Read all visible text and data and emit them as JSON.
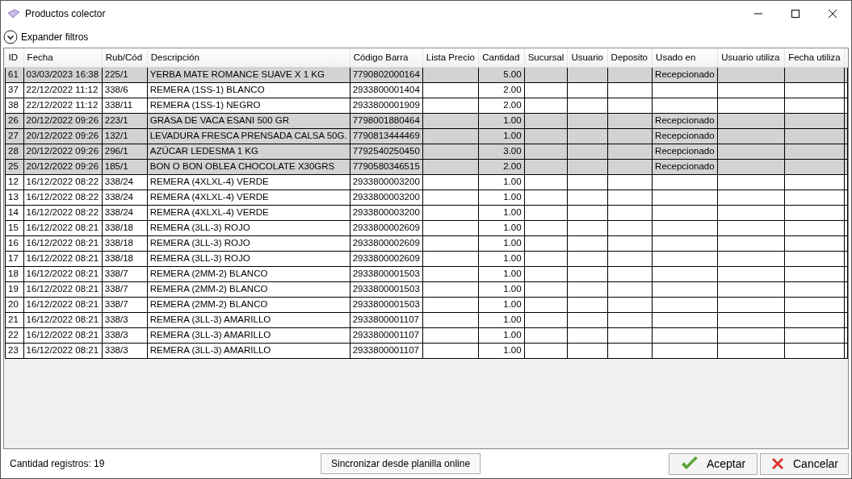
{
  "window": {
    "title": "Productos colector"
  },
  "filters_toggle": {
    "label": "Expander filtros",
    "expanded": false
  },
  "table": {
    "columns": [
      "ID",
      "Fecha",
      "Rub/Cód",
      "Descripción",
      "Código Barra",
      "Lista Precio",
      "Cantidad",
      "Sucursal",
      "Usuario",
      "Deposito",
      "Usado en",
      "Usuario utiliza",
      "Fecha utiliza"
    ],
    "rows": [
      {
        "highlighted": true,
        "cells": [
          "61",
          "03/03/2023 16:38",
          "225/1",
          "YERBA MATE ROMANCE SUAVE X 1 KG",
          "7790802000164",
          "",
          "5.00",
          "",
          "",
          "",
          "Recepcionado",
          "",
          ""
        ]
      },
      {
        "highlighted": false,
        "cells": [
          "37",
          "22/12/2022 11:12",
          "338/6",
          "REMERA (1SS-1) BLANCO",
          "2933800001404",
          "",
          "2.00",
          "",
          "",
          "",
          "",
          "",
          ""
        ]
      },
      {
        "highlighted": false,
        "cells": [
          "38",
          "22/12/2022 11:12",
          "338/11",
          "REMERA (1SS-1) NEGRO",
          "2933800001909",
          "",
          "2.00",
          "",
          "",
          "",
          "",
          "",
          ""
        ]
      },
      {
        "highlighted": true,
        "cells": [
          "26",
          "20/12/2022 09:26",
          "223/1",
          "GRASA DE VACA ESANI 500 GR",
          "7798001880464",
          "",
          "1.00",
          "",
          "",
          "",
          "Recepcionado",
          "",
          ""
        ]
      },
      {
        "highlighted": true,
        "cells": [
          "27",
          "20/12/2022 09:26",
          "132/1",
          "LEVADURA FRESCA PRENSADA CALSA 50G.",
          "7790813444469",
          "",
          "1.00",
          "",
          "",
          "",
          "Recepcionado",
          "",
          ""
        ]
      },
      {
        "highlighted": true,
        "cells": [
          "28",
          "20/12/2022 09:26",
          "296/1",
          "AZÚCAR LEDESMA 1 KG",
          "7792540250450",
          "",
          "3.00",
          "",
          "",
          "",
          "Recepcionado",
          "",
          ""
        ]
      },
      {
        "highlighted": true,
        "cells": [
          "25",
          "20/12/2022 09:26",
          "185/1",
          "BON O BON OBLEA CHOCOLATE X30GRS",
          "7790580346515",
          "",
          "2.00",
          "",
          "",
          "",
          "Recepcionado",
          "",
          ""
        ]
      },
      {
        "highlighted": false,
        "cells": [
          "12",
          "16/12/2022 08:22",
          "338/24",
          "REMERA (4XLXL-4) VERDE",
          "2933800003200",
          "",
          "1.00",
          "",
          "",
          "",
          "",
          "",
          ""
        ]
      },
      {
        "highlighted": false,
        "cells": [
          "13",
          "16/12/2022 08:22",
          "338/24",
          "REMERA (4XLXL-4) VERDE",
          "2933800003200",
          "",
          "1.00",
          "",
          "",
          "",
          "",
          "",
          ""
        ]
      },
      {
        "highlighted": false,
        "cells": [
          "14",
          "16/12/2022 08:22",
          "338/24",
          "REMERA (4XLXL-4) VERDE",
          "2933800003200",
          "",
          "1.00",
          "",
          "",
          "",
          "",
          "",
          ""
        ]
      },
      {
        "highlighted": false,
        "cells": [
          "15",
          "16/12/2022 08:21",
          "338/18",
          "REMERA (3LL-3) ROJO",
          "2933800002609",
          "",
          "1.00",
          "",
          "",
          "",
          "",
          "",
          ""
        ]
      },
      {
        "highlighted": false,
        "cells": [
          "16",
          "16/12/2022 08:21",
          "338/18",
          "REMERA (3LL-3) ROJO",
          "2933800002609",
          "",
          "1.00",
          "",
          "",
          "",
          "",
          "",
          ""
        ]
      },
      {
        "highlighted": false,
        "cells": [
          "17",
          "16/12/2022 08:21",
          "338/18",
          "REMERA (3LL-3) ROJO",
          "2933800002609",
          "",
          "1.00",
          "",
          "",
          "",
          "",
          "",
          ""
        ]
      },
      {
        "highlighted": false,
        "cells": [
          "18",
          "16/12/2022 08:21",
          "338/7",
          "REMERA (2MM-2) BLANCO",
          "2933800001503",
          "",
          "1.00",
          "",
          "",
          "",
          "",
          "",
          ""
        ]
      },
      {
        "highlighted": false,
        "cells": [
          "19",
          "16/12/2022 08:21",
          "338/7",
          "REMERA (2MM-2) BLANCO",
          "2933800001503",
          "",
          "1.00",
          "",
          "",
          "",
          "",
          "",
          ""
        ]
      },
      {
        "highlighted": false,
        "cells": [
          "20",
          "16/12/2022 08:21",
          "338/7",
          "REMERA (2MM-2) BLANCO",
          "2933800001503",
          "",
          "1.00",
          "",
          "",
          "",
          "",
          "",
          ""
        ]
      },
      {
        "highlighted": false,
        "cells": [
          "21",
          "16/12/2022 08:21",
          "338/3",
          "REMERA (3LL-3) AMARILLO",
          "2933800001107",
          "",
          "1.00",
          "",
          "",
          "",
          "",
          "",
          ""
        ]
      },
      {
        "highlighted": false,
        "cells": [
          "22",
          "16/12/2022 08:21",
          "338/3",
          "REMERA (3LL-3) AMARILLO",
          "2933800001107",
          "",
          "1.00",
          "",
          "",
          "",
          "",
          "",
          ""
        ]
      },
      {
        "highlighted": false,
        "cells": [
          "23",
          "16/12/2022 08:21",
          "338/3",
          "REMERA (3LL-3) AMARILLO",
          "2933800001107",
          "",
          "1.00",
          "",
          "",
          "",
          "",
          "",
          ""
        ]
      }
    ]
  },
  "status_bar": {
    "record_count": "Cantidad registros: 19"
  },
  "buttons": [
    {
      "kind": "sync",
      "label": "Sincronizar desde planilla online"
    },
    {
      "kind": "accept",
      "label": "Aceptar"
    },
    {
      "kind": "cancel",
      "label": "Cancelar"
    }
  ]
}
